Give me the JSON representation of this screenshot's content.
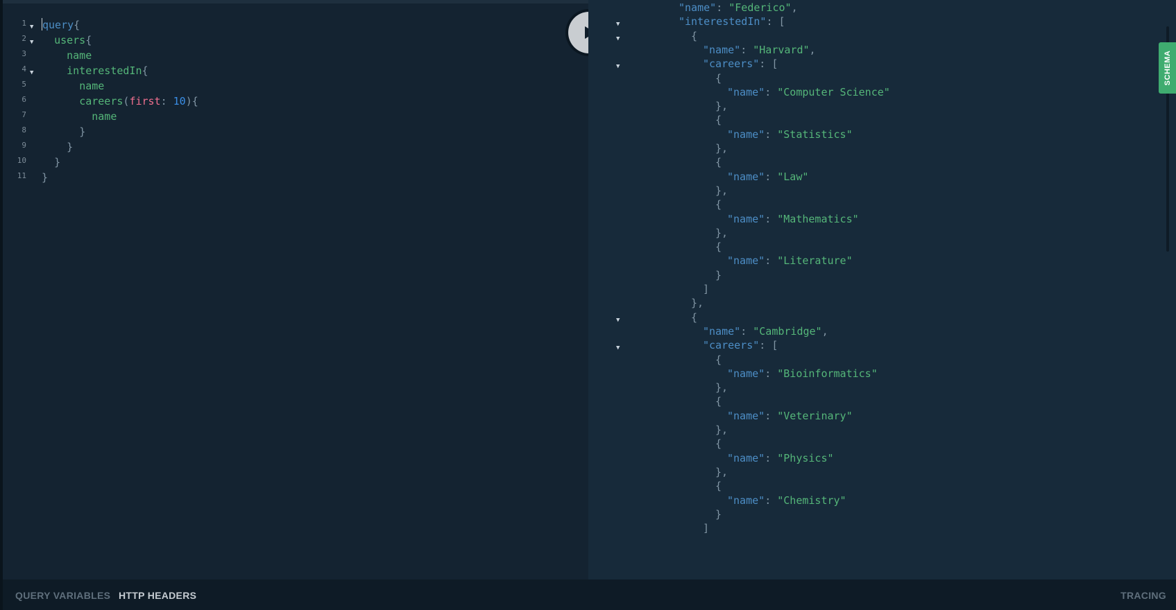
{
  "editor": {
    "lines": [
      {
        "num": "1",
        "fold": true,
        "parts": [
          {
            "t": "query",
            "c": "kw blue"
          },
          {
            "t": "{",
            "c": "punc"
          }
        ]
      },
      {
        "num": "2",
        "fold": true,
        "parts": [
          {
            "t": "  ",
            "c": ""
          },
          {
            "t": "users",
            "c": "kw"
          },
          {
            "t": "{",
            "c": "punc"
          }
        ]
      },
      {
        "num": "3",
        "fold": false,
        "parts": [
          {
            "t": "    ",
            "c": ""
          },
          {
            "t": "name",
            "c": "kw"
          }
        ]
      },
      {
        "num": "4",
        "fold": true,
        "parts": [
          {
            "t": "    ",
            "c": ""
          },
          {
            "t": "interestedIn",
            "c": "kw"
          },
          {
            "t": "{",
            "c": "punc"
          }
        ]
      },
      {
        "num": "5",
        "fold": false,
        "parts": [
          {
            "t": "      ",
            "c": ""
          },
          {
            "t": "name",
            "c": "kw"
          }
        ]
      },
      {
        "num": "6",
        "fold": false,
        "parts": [
          {
            "t": "      ",
            "c": ""
          },
          {
            "t": "careers",
            "c": "kw"
          },
          {
            "t": "(",
            "c": "punc"
          },
          {
            "t": "first",
            "c": "arg"
          },
          {
            "t": ": ",
            "c": "punc"
          },
          {
            "t": "10",
            "c": "num"
          },
          {
            "t": "){",
            "c": "punc"
          }
        ]
      },
      {
        "num": "7",
        "fold": false,
        "parts": [
          {
            "t": "        ",
            "c": ""
          },
          {
            "t": "name",
            "c": "kw"
          }
        ]
      },
      {
        "num": "8",
        "fold": false,
        "parts": [
          {
            "t": "      ",
            "c": ""
          },
          {
            "t": "}",
            "c": "punc"
          }
        ]
      },
      {
        "num": "9",
        "fold": false,
        "parts": [
          {
            "t": "    ",
            "c": ""
          },
          {
            "t": "}",
            "c": "punc"
          }
        ]
      },
      {
        "num": "10",
        "fold": false,
        "parts": [
          {
            "t": "  ",
            "c": ""
          },
          {
            "t": "}",
            "c": "punc"
          }
        ]
      },
      {
        "num": "11",
        "fold": false,
        "parts": [
          {
            "t": "}",
            "c": "punc"
          }
        ]
      }
    ]
  },
  "run_button": {
    "icon": "play-icon"
  },
  "result": {
    "lines": [
      {
        "indent": 2,
        "fold": false,
        "parts": [
          {
            "t": "\"name\"",
            "c": "key"
          },
          {
            "t": ": ",
            "c": "p"
          },
          {
            "t": "\"Federico\"",
            "c": "str"
          },
          {
            "t": ",",
            "c": "p"
          }
        ]
      },
      {
        "indent": 2,
        "fold": true,
        "parts": [
          {
            "t": "\"interestedIn\"",
            "c": "key"
          },
          {
            "t": ": [",
            "c": "p"
          }
        ]
      },
      {
        "indent": 3,
        "fold": true,
        "parts": [
          {
            "t": "{",
            "c": "p"
          }
        ]
      },
      {
        "indent": 4,
        "fold": false,
        "parts": [
          {
            "t": "\"name\"",
            "c": "key"
          },
          {
            "t": ": ",
            "c": "p"
          },
          {
            "t": "\"Harvard\"",
            "c": "str"
          },
          {
            "t": ",",
            "c": "p"
          }
        ]
      },
      {
        "indent": 4,
        "fold": true,
        "parts": [
          {
            "t": "\"careers\"",
            "c": "key"
          },
          {
            "t": ": [",
            "c": "p"
          }
        ]
      },
      {
        "indent": 5,
        "fold": false,
        "parts": [
          {
            "t": "{",
            "c": "p"
          }
        ]
      },
      {
        "indent": 6,
        "fold": false,
        "parts": [
          {
            "t": "\"name\"",
            "c": "key"
          },
          {
            "t": ": ",
            "c": "p"
          },
          {
            "t": "\"Computer Science\"",
            "c": "str"
          }
        ]
      },
      {
        "indent": 5,
        "fold": false,
        "parts": [
          {
            "t": "},",
            "c": "p"
          }
        ]
      },
      {
        "indent": 5,
        "fold": false,
        "parts": [
          {
            "t": "{",
            "c": "p"
          }
        ]
      },
      {
        "indent": 6,
        "fold": false,
        "parts": [
          {
            "t": "\"name\"",
            "c": "key"
          },
          {
            "t": ": ",
            "c": "p"
          },
          {
            "t": "\"Statistics\"",
            "c": "str"
          }
        ]
      },
      {
        "indent": 5,
        "fold": false,
        "parts": [
          {
            "t": "},",
            "c": "p"
          }
        ]
      },
      {
        "indent": 5,
        "fold": false,
        "parts": [
          {
            "t": "{",
            "c": "p"
          }
        ]
      },
      {
        "indent": 6,
        "fold": false,
        "parts": [
          {
            "t": "\"name\"",
            "c": "key"
          },
          {
            "t": ": ",
            "c": "p"
          },
          {
            "t": "\"Law\"",
            "c": "str"
          }
        ]
      },
      {
        "indent": 5,
        "fold": false,
        "parts": [
          {
            "t": "},",
            "c": "p"
          }
        ]
      },
      {
        "indent": 5,
        "fold": false,
        "parts": [
          {
            "t": "{",
            "c": "p"
          }
        ]
      },
      {
        "indent": 6,
        "fold": false,
        "parts": [
          {
            "t": "\"name\"",
            "c": "key"
          },
          {
            "t": ": ",
            "c": "p"
          },
          {
            "t": "\"Mathematics\"",
            "c": "str"
          }
        ]
      },
      {
        "indent": 5,
        "fold": false,
        "parts": [
          {
            "t": "},",
            "c": "p"
          }
        ]
      },
      {
        "indent": 5,
        "fold": false,
        "parts": [
          {
            "t": "{",
            "c": "p"
          }
        ]
      },
      {
        "indent": 6,
        "fold": false,
        "parts": [
          {
            "t": "\"name\"",
            "c": "key"
          },
          {
            "t": ": ",
            "c": "p"
          },
          {
            "t": "\"Literature\"",
            "c": "str"
          }
        ]
      },
      {
        "indent": 5,
        "fold": false,
        "parts": [
          {
            "t": "}",
            "c": "p"
          }
        ]
      },
      {
        "indent": 4,
        "fold": false,
        "parts": [
          {
            "t": "]",
            "c": "p"
          }
        ]
      },
      {
        "indent": 3,
        "fold": false,
        "parts": [
          {
            "t": "},",
            "c": "p"
          }
        ]
      },
      {
        "indent": 3,
        "fold": true,
        "parts": [
          {
            "t": "{",
            "c": "p"
          }
        ]
      },
      {
        "indent": 4,
        "fold": false,
        "parts": [
          {
            "t": "\"name\"",
            "c": "key"
          },
          {
            "t": ": ",
            "c": "p"
          },
          {
            "t": "\"Cambridge\"",
            "c": "str"
          },
          {
            "t": ",",
            "c": "p"
          }
        ]
      },
      {
        "indent": 4,
        "fold": true,
        "parts": [
          {
            "t": "\"careers\"",
            "c": "key"
          },
          {
            "t": ": [",
            "c": "p"
          }
        ]
      },
      {
        "indent": 5,
        "fold": false,
        "parts": [
          {
            "t": "{",
            "c": "p"
          }
        ]
      },
      {
        "indent": 6,
        "fold": false,
        "parts": [
          {
            "t": "\"name\"",
            "c": "key"
          },
          {
            "t": ": ",
            "c": "p"
          },
          {
            "t": "\"Bioinformatics\"",
            "c": "str"
          }
        ]
      },
      {
        "indent": 5,
        "fold": false,
        "parts": [
          {
            "t": "},",
            "c": "p"
          }
        ]
      },
      {
        "indent": 5,
        "fold": false,
        "parts": [
          {
            "t": "{",
            "c": "p"
          }
        ]
      },
      {
        "indent": 6,
        "fold": false,
        "parts": [
          {
            "t": "\"name\"",
            "c": "key"
          },
          {
            "t": ": ",
            "c": "p"
          },
          {
            "t": "\"Veterinary\"",
            "c": "str"
          }
        ]
      },
      {
        "indent": 5,
        "fold": false,
        "parts": [
          {
            "t": "},",
            "c": "p"
          }
        ]
      },
      {
        "indent": 5,
        "fold": false,
        "parts": [
          {
            "t": "{",
            "c": "p"
          }
        ]
      },
      {
        "indent": 6,
        "fold": false,
        "parts": [
          {
            "t": "\"name\"",
            "c": "key"
          },
          {
            "t": ": ",
            "c": "p"
          },
          {
            "t": "\"Physics\"",
            "c": "str"
          }
        ]
      },
      {
        "indent": 5,
        "fold": false,
        "parts": [
          {
            "t": "},",
            "c": "p"
          }
        ]
      },
      {
        "indent": 5,
        "fold": false,
        "parts": [
          {
            "t": "{",
            "c": "p"
          }
        ]
      },
      {
        "indent": 6,
        "fold": false,
        "parts": [
          {
            "t": "\"name\"",
            "c": "key"
          },
          {
            "t": ": ",
            "c": "p"
          },
          {
            "t": "\"Chemistry\"",
            "c": "str"
          }
        ]
      },
      {
        "indent": 5,
        "fold": false,
        "parts": [
          {
            "t": "}",
            "c": "p"
          }
        ]
      },
      {
        "indent": 4,
        "fold": false,
        "parts": [
          {
            "t": "]",
            "c": "p"
          }
        ]
      }
    ]
  },
  "schema_tab": {
    "label": "SCHEMA"
  },
  "bottom_bar": {
    "query_variables": "QUERY VARIABLES",
    "http_headers": "HTTP HEADERS",
    "tracing": "TRACING"
  },
  "colors": {
    "editor_bg": "#142331",
    "result_bg": "#172a3a",
    "string_green": "#55b679",
    "key_blue": "#4d8ec6",
    "arg_pink": "#ef6f8e",
    "number_blue": "#3a8ee6",
    "schema_green": "#3fac70"
  }
}
